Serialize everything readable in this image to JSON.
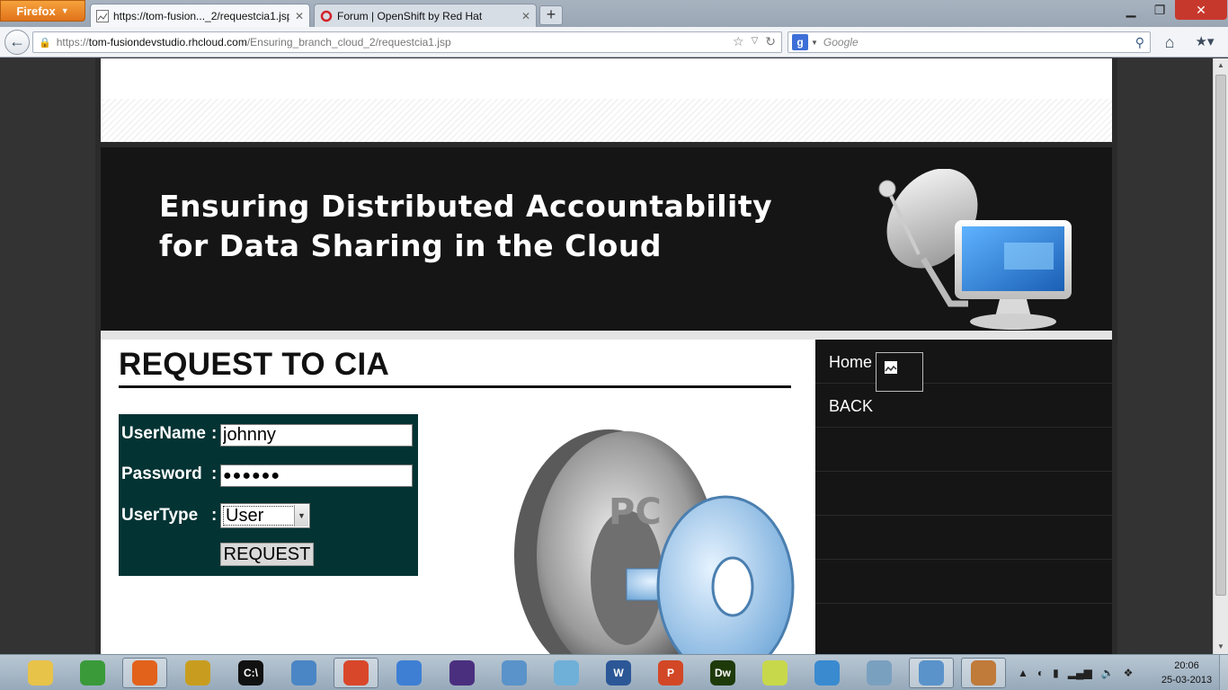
{
  "browser": {
    "app_button": "Firefox",
    "tabs": [
      {
        "title": "https://tom-fusion..._2/requestcia1.jsp",
        "active": true
      },
      {
        "title": "Forum | OpenShift by Red Hat",
        "active": false
      }
    ],
    "url": {
      "protocol": "https://",
      "host": "tom-fusiondevstudio.rhcloud.com",
      "path": "/Ensuring_branch_cloud_2/requestcia1.jsp"
    },
    "search": {
      "engine": "Google",
      "placeholder": "Google"
    }
  },
  "site": {
    "banner_line1": "Ensuring Distributed Accountability",
    "banner_line2": "for Data Sharing in the Cloud",
    "heading": "REQUEST TO CIA",
    "form": {
      "username_label": "UserName",
      "username_value": "johnny",
      "password_label": "Password",
      "password_value": "●●●●●●",
      "usertype_label": "UserType",
      "usertype_value": "User",
      "colon": ":",
      "submit_label": "REQUEST"
    },
    "art_text": "PC",
    "menu": [
      {
        "label": "Home"
      },
      {
        "label": "BACK"
      },
      {
        "label": ""
      },
      {
        "label": ""
      },
      {
        "label": ""
      },
      {
        "label": ""
      },
      {
        "label": ""
      }
    ]
  },
  "taskbar": {
    "apps": [
      {
        "name": "file-explorer-icon",
        "color": "#e8c34a",
        "glyph": ""
      },
      {
        "name": "chrome-icon",
        "color": "#3a9a3a",
        "glyph": ""
      },
      {
        "name": "firefox-icon",
        "color": "#e2621b",
        "glyph": "",
        "active": true
      },
      {
        "name": "filezilla-icon",
        "color": "#c89d1f",
        "glyph": ""
      },
      {
        "name": "cmd-icon",
        "color": "#111111",
        "glyph": "C:\\"
      },
      {
        "name": "virtualbox-guest-icon",
        "color": "#4a86c5",
        "glyph": ""
      },
      {
        "name": "git-icon",
        "color": "#d9472b",
        "glyph": "",
        "active": true
      },
      {
        "name": "itunes-icon",
        "color": "#3e7fd4",
        "glyph": ""
      },
      {
        "name": "eclipse-icon",
        "color": "#4b2f7f",
        "glyph": ""
      },
      {
        "name": "virtualbox-icon",
        "color": "#5a93c9",
        "glyph": ""
      },
      {
        "name": "notepad-icon",
        "color": "#6fb0d8",
        "glyph": ""
      },
      {
        "name": "word-icon",
        "color": "#2b5797",
        "glyph": "W"
      },
      {
        "name": "powerpoint-icon",
        "color": "#d24726",
        "glyph": "P"
      },
      {
        "name": "dreamweaver-icon",
        "color": "#1e3a0a",
        "glyph": "Dw"
      },
      {
        "name": "sticky-notes-icon",
        "color": "#c8d84b",
        "glyph": ""
      },
      {
        "name": "control-panel-icon",
        "color": "#3a8ad0",
        "glyph": ""
      },
      {
        "name": "task-manager-icon",
        "color": "#7aa0c0",
        "glyph": ""
      },
      {
        "name": "virtualbox-vm-icon",
        "color": "#5a93c9",
        "glyph": "",
        "active": true
      },
      {
        "name": "paint-icon",
        "color": "#c07a3a",
        "glyph": "",
        "active": true
      }
    ],
    "clock_time": "20:06",
    "clock_date": "25-03-2013"
  }
}
